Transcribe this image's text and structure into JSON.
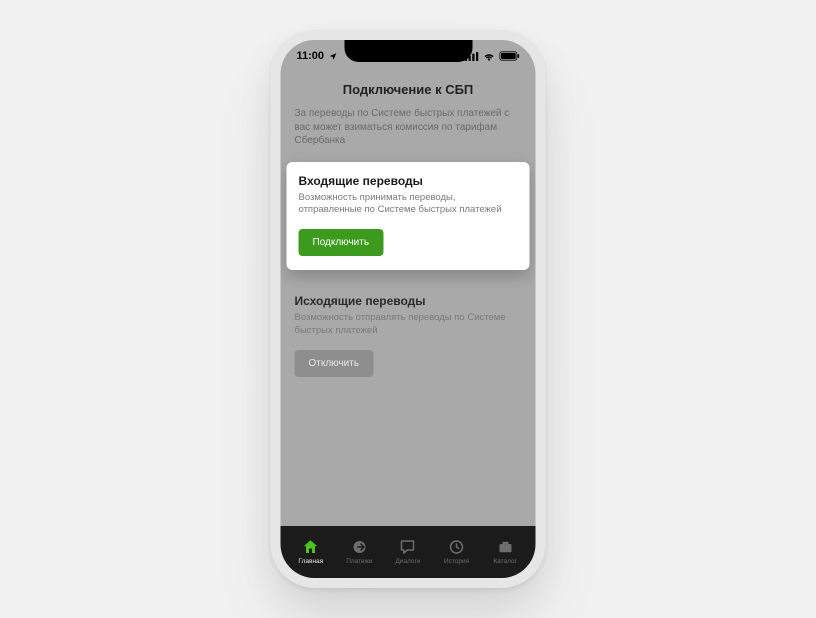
{
  "status": {
    "time": "11:00"
  },
  "page": {
    "title": "Подключение к СБП",
    "intro": "За переводы по Системе быстрых платежей с вас может взиматься комиссия по тарифам Сбербанка"
  },
  "incoming": {
    "title": "Входящие переводы",
    "desc": "Возможность принимать переводы, отправленные по Системе быстрых платежей",
    "button": "Подключить"
  },
  "outgoing": {
    "title": "Исходящие переводы",
    "desc": "Возможность отправлять переводы по Системе быстрых платежей",
    "button": "Отключить"
  },
  "tabs": {
    "home": "Главная",
    "payments": "Платежи",
    "dialogs": "Диалоги",
    "history": "История",
    "catalog": "Каталог"
  },
  "colors": {
    "accent": "#3c9b1e",
    "tab_active": "#4cc21f"
  }
}
